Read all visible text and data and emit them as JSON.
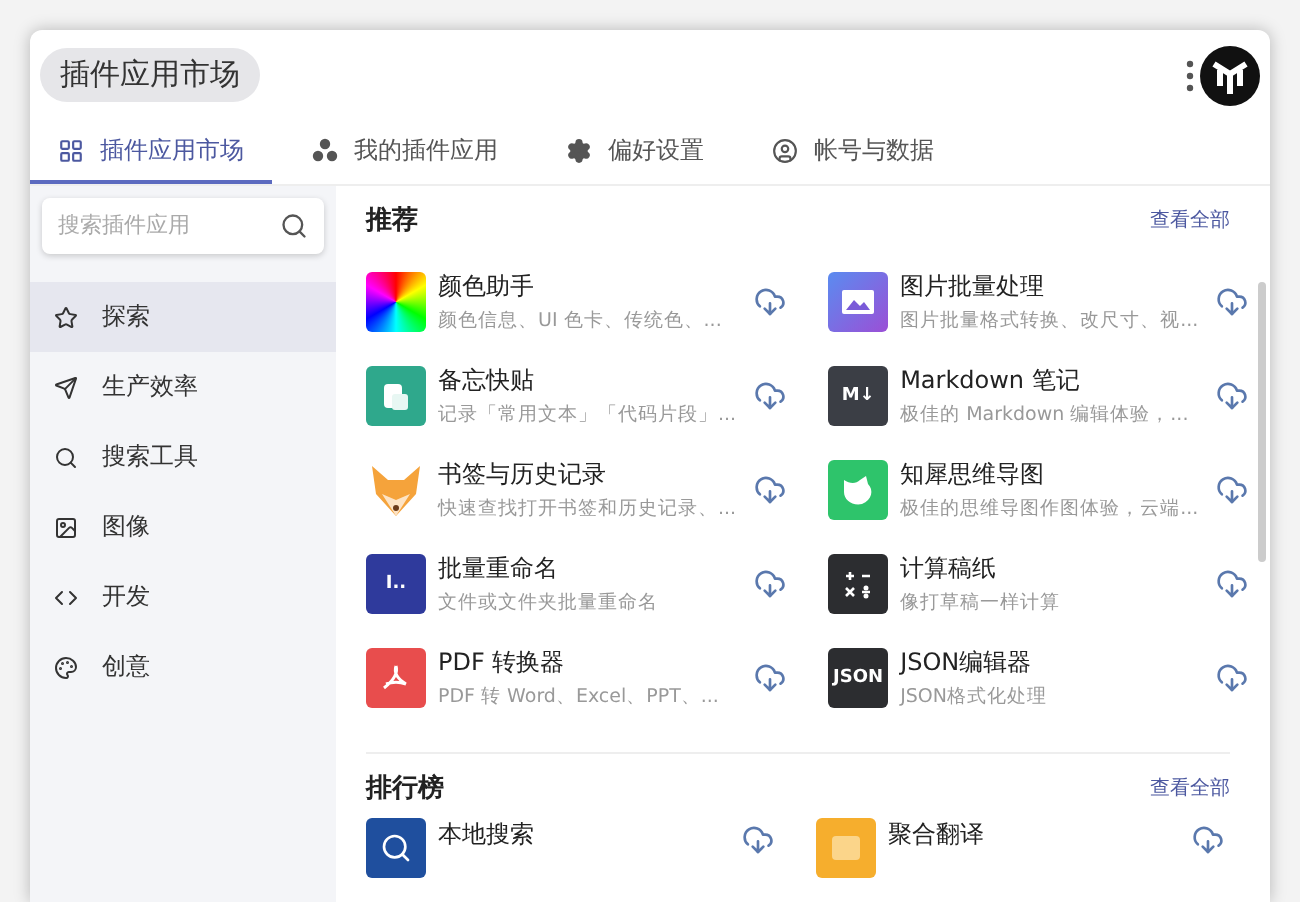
{
  "window": {
    "title": "插件应用市场"
  },
  "tabs": [
    {
      "label": "插件应用市场",
      "selected": true
    },
    {
      "label": "我的插件应用",
      "selected": false
    },
    {
      "label": "偏好设置",
      "selected": false
    },
    {
      "label": "帐号与数据",
      "selected": false
    }
  ],
  "sidebar": {
    "search": {
      "placeholder": "搜索插件应用"
    },
    "items": [
      {
        "label": "探索",
        "selected": true
      },
      {
        "label": "生产效率",
        "selected": false
      },
      {
        "label": "搜索工具",
        "selected": false
      },
      {
        "label": "图像",
        "selected": false
      },
      {
        "label": "开发",
        "selected": false
      },
      {
        "label": "创意",
        "selected": false
      }
    ]
  },
  "sections": [
    {
      "title": "推荐",
      "link": "查看全部",
      "items": [
        {
          "name": "颜色助手",
          "description": "颜色信息、UI 色卡、传统色、..."
        },
        {
          "name": "图片批量处理",
          "description": "图片批量格式转换、改尺寸、视..."
        },
        {
          "name": "备忘快贴",
          "description": "记录「常用文本」「代码片段」..."
        },
        {
          "name": "Markdown 笔记",
          "description": "极佳的 Markdown 编辑体验，...",
          "icon_label": "M↓"
        },
        {
          "name": "书签与历史记录",
          "description": "快速查找打开书签和历史记录、..."
        },
        {
          "name": "知犀思维导图",
          "description": "极佳的思维导图作图体验，云端..."
        },
        {
          "name": "批量重命名",
          "description": "文件或文件夹批量重命名",
          "icon_label": "I.."
        },
        {
          "name": "计算稿纸",
          "description": "像打草稿一样计算"
        },
        {
          "name": "PDF 转换器",
          "description": "PDF 转 Word、Excel、PPT、..."
        },
        {
          "name": "JSON编辑器",
          "description": "JSON格式化处理",
          "icon_label": "JSON"
        }
      ]
    },
    {
      "title": "排行榜",
      "link": "查看全部",
      "items": [
        {
          "name": "本地搜索"
        },
        {
          "name": "聚合翻译"
        }
      ]
    }
  ]
}
